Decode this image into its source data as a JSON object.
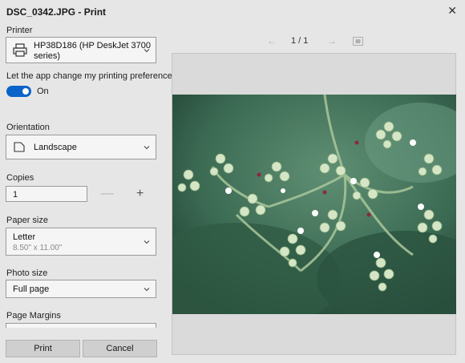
{
  "window": {
    "title": "DSC_0342.JPG - Print",
    "close_icon": "✕"
  },
  "printer": {
    "label": "Printer",
    "value_line1": "HP38D186 (HP DeskJet 3700",
    "value_line2": "series)"
  },
  "preferences": {
    "label": "Let the app change my printing preferences",
    "toggle_state": "On"
  },
  "orientation": {
    "label": "Orientation",
    "value": "Landscape"
  },
  "copies": {
    "label": "Copies",
    "value": "1",
    "minus": "—",
    "plus": "+"
  },
  "paper_size": {
    "label": "Paper size",
    "value": "Letter",
    "detail": "8.50\" x 11.00\""
  },
  "photo_size": {
    "label": "Photo size",
    "value": "Full page"
  },
  "page_margins": {
    "label": "Page Margins"
  },
  "buttons": {
    "print": "Print",
    "cancel": "Cancel"
  },
  "preview": {
    "page_indicator": "1 / 1",
    "prev_icon": "←",
    "next_icon": "→"
  },
  "colors": {
    "accent": "#0a63c9",
    "background": "#e6e6e6"
  }
}
